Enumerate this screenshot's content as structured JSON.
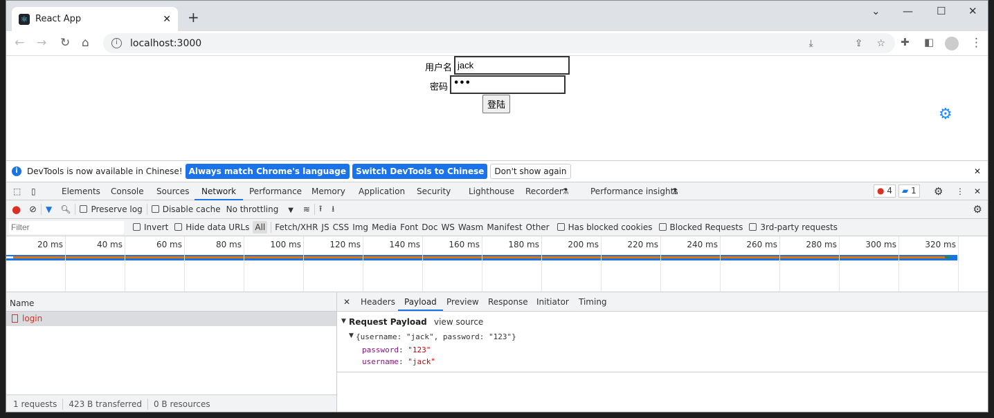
{
  "browser": {
    "tab_title": "React App",
    "url": "localhost:3000",
    "tab_favicon": "react-icon"
  },
  "page": {
    "username_label": "用户名",
    "username_value": "jack",
    "password_label": "密码",
    "password_value": "•••",
    "login_button": "登陆"
  },
  "infobar": {
    "message": "DevTools is now available in Chinese!",
    "btn_always": "Always match Chrome's language",
    "btn_switch": "Switch DevTools to Chinese",
    "btn_dont_show": "Don't show again"
  },
  "devtools": {
    "tabs": [
      "Elements",
      "Console",
      "Sources",
      "Network",
      "Performance",
      "Memory",
      "Application",
      "Security",
      "Lighthouse",
      "Recorder",
      "Performance insights"
    ],
    "active_tab": "Network",
    "error_count": "4",
    "message_count": "1",
    "toolbar": {
      "preserve_log": "Preserve log",
      "disable_cache": "Disable cache",
      "throttling": "No throttling"
    },
    "filter": {
      "placeholder": "Filter",
      "invert": "Invert",
      "hide_data_urls": "Hide data URLs",
      "types": [
        "All",
        "Fetch/XHR",
        "JS",
        "CSS",
        "Img",
        "Media",
        "Font",
        "Doc",
        "WS",
        "Wasm",
        "Manifest",
        "Other"
      ],
      "has_blocked_cookies": "Has blocked cookies",
      "blocked_requests": "Blocked Requests",
      "third_party": "3rd-party requests"
    },
    "timeline_ticks": [
      "20 ms",
      "40 ms",
      "60 ms",
      "80 ms",
      "100 ms",
      "120 ms",
      "140 ms",
      "160 ms",
      "180 ms",
      "200 ms",
      "220 ms",
      "240 ms",
      "260 ms",
      "280 ms",
      "300 ms",
      "320 ms"
    ],
    "requests": {
      "header": "Name",
      "items": [
        {
          "name": "login"
        }
      ]
    },
    "status": {
      "requests": "1 requests",
      "transferred": "423 B transferred",
      "resources": "0 B resources"
    },
    "detail_tabs": [
      "Headers",
      "Payload",
      "Preview",
      "Response",
      "Initiator",
      "Timing"
    ],
    "active_detail_tab": "Payload",
    "payload": {
      "title": "Request Payload",
      "view_source": "view source",
      "summary": "{username: \"jack\", password: \"123\"}",
      "fields": [
        {
          "key": "password",
          "value": "\"123\""
        },
        {
          "key": "username",
          "value": "\"jack\""
        }
      ]
    }
  },
  "colors": {
    "accent": "#1a73e8",
    "error": "#d93025",
    "gear": "#1a8cff"
  }
}
